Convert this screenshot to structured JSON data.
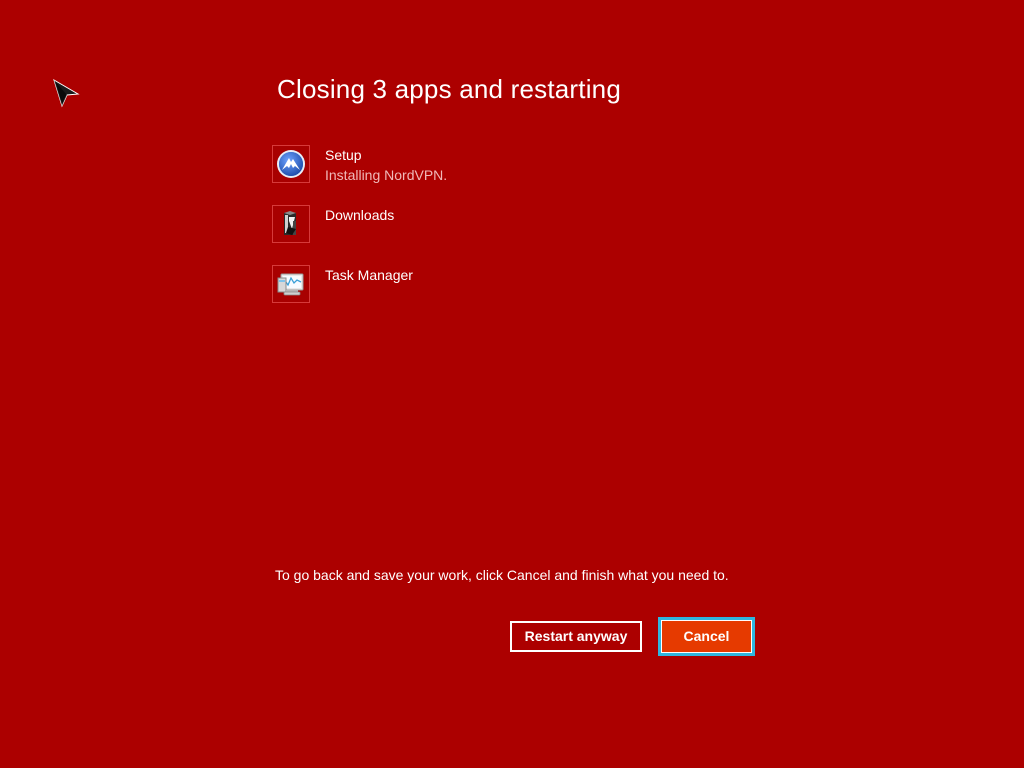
{
  "dialog": {
    "title": "Closing 3 apps and restarting",
    "apps": [
      {
        "name": "Setup",
        "status": "Installing NordVPN.",
        "icon": "nordvpn-icon"
      },
      {
        "name": "Downloads",
        "status": "",
        "icon": "downloads-folder-icon"
      },
      {
        "name": "Task Manager",
        "status": "",
        "icon": "task-manager-icon"
      }
    ],
    "message": "To go back and save your work, click Cancel and finish what you need to.",
    "restart_label": "Restart anyway",
    "cancel_label": "Cancel"
  },
  "colors": {
    "background": "#ac0000",
    "cancel_button": "#e63a00",
    "focus_ring": "#2fb6e0"
  }
}
